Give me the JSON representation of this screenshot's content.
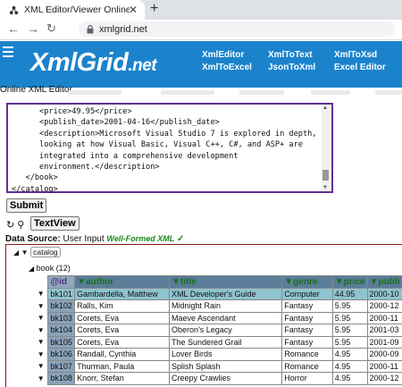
{
  "browser": {
    "tab_title": "XML Editor/Viewer Online - xmlG",
    "url": "xmlgrid.net"
  },
  "header": {
    "logo_main": "XmlGrid",
    "logo_suffix": ".net",
    "nav": [
      "XmlEditor",
      "XmlToText",
      "XmlToXsd",
      "XmlToExcel",
      "JsonToXml",
      "Excel Editor"
    ]
  },
  "subtitle": "Online XML Editor",
  "editor": {
    "text": "      <price>49.95</price>\n      <publish_date>2001-04-16</publish_date>\n      <description>Microsoft Visual Studio 7 is explored in depth,\n      looking at how Visual Basic, Visual C++, C#, and ASP+ are\n      integrated into a comprehensive development\n      environment.</description>\n   </book>\n</catalog>"
  },
  "buttons": {
    "submit": "Submit",
    "textview": "TextView"
  },
  "data_source": {
    "label": "Data Source:",
    "value": "User Input",
    "status": "Well-Formed XML"
  },
  "tree": {
    "root": "catalog",
    "group": "book (12)"
  },
  "table": {
    "headers": [
      "@id",
      "author",
      "title",
      "genre",
      "price",
      "publi"
    ],
    "rows": [
      [
        "bk101",
        "Gambardella, Matthew",
        "XML Developer's Guide",
        "Computer",
        "44.95",
        "2000-10"
      ],
      [
        "bk102",
        "Ralls, Kim",
        "Midnight Rain",
        "Fantasy",
        "5.95",
        "2000-12"
      ],
      [
        "bk103",
        "Corets, Eva",
        "Maeve Ascendant",
        "Fantasy",
        "5.95",
        "2000-11"
      ],
      [
        "bk104",
        "Corets, Eva",
        "Oberon's Legacy",
        "Fantasy",
        "5.95",
        "2001-03"
      ],
      [
        "bk105",
        "Corets, Eva",
        "The Sundered Grail",
        "Fantasy",
        "5.95",
        "2001-09"
      ],
      [
        "bk106",
        "Randall, Cynthia",
        "Lover Birds",
        "Romance",
        "4.95",
        "2000-09"
      ],
      [
        "bk107",
        "Thurman, Paula",
        "Splish Splash",
        "Romance",
        "4.95",
        "2000-11"
      ],
      [
        "bk108",
        "Knorr, Stefan",
        "Creepy Crawlies",
        "Horror",
        "4.95",
        "2000-12"
      ]
    ]
  },
  "colors": {
    "header_bg": "#1b83cc",
    "editor_border": "#5e2e93",
    "selected_row": "#8fc3cf"
  }
}
